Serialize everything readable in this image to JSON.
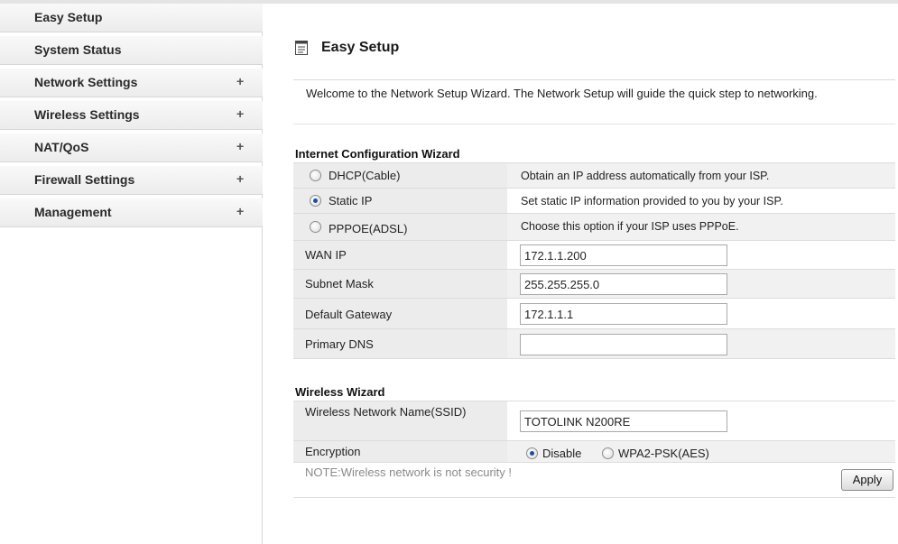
{
  "sidebar": {
    "items": [
      {
        "label": "Easy Setup",
        "plus": ""
      },
      {
        "label": "System Status",
        "plus": ""
      },
      {
        "label": "Network Settings",
        "plus": "+"
      },
      {
        "label": "Wireless Settings",
        "plus": "+"
      },
      {
        "label": "NAT/QoS",
        "plus": "+"
      },
      {
        "label": "Firewall Settings",
        "plus": "+"
      },
      {
        "label": "Management",
        "plus": "+"
      }
    ]
  },
  "page": {
    "title": "Easy Setup",
    "icon": "page-icon",
    "welcome": "Welcome to the Network Setup Wizard. The Network Setup will guide the quick step to networking."
  },
  "internet": {
    "title": "Internet Configuration Wizard",
    "options": [
      {
        "label": "DHCP(Cable)",
        "desc": "Obtain an IP address automatically from your ISP.",
        "checked": false
      },
      {
        "label": "Static IP",
        "desc": "Set static IP information provided to you by your ISP.",
        "checked": true
      },
      {
        "label": "PPPOE(ADSL)",
        "desc": "Choose this option if your ISP uses PPPoE.",
        "checked": false
      }
    ],
    "fields": [
      {
        "label": "WAN IP",
        "value": "172.1.1.200"
      },
      {
        "label": "Subnet Mask",
        "value": "255.255.255.0"
      },
      {
        "label": "Default Gateway",
        "value": "172.1.1.1"
      },
      {
        "label": "Primary DNS",
        "value": ""
      }
    ]
  },
  "wireless": {
    "title": "Wireless Wizard",
    "ssid_label": "Wireless Network Name(SSID)",
    "ssid_value": "TOTOLINK N200RE",
    "encryption_label": "Encryption",
    "encryption_options": [
      {
        "label": "Disable",
        "checked": true
      },
      {
        "label": "WPA2-PSK(AES)",
        "checked": false
      }
    ],
    "note": "NOTE:Wireless network is not security !",
    "apply_label": "Apply"
  },
  "colors": {
    "sidebar_bg": "#ececec",
    "row_shade": "#f1f1f1",
    "radio_dot": "#1f4f9a"
  }
}
